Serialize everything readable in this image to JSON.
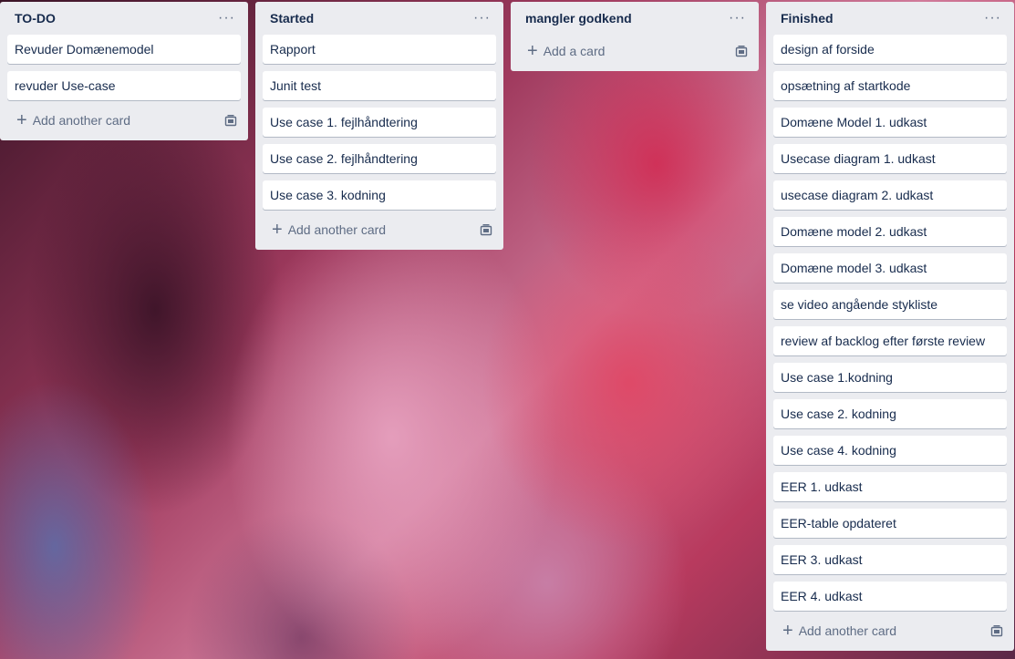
{
  "lists": [
    {
      "title": "TO-DO",
      "menu_icon": "···",
      "cards": [
        "Revuder Domænemodel",
        "revuder Use-case"
      ],
      "add_label": "Add another card"
    },
    {
      "title": "Started",
      "menu_icon": "···",
      "cards": [
        "Rapport",
        "Junit test",
        "Use case 1. fejlhåndtering",
        "Use case 2. fejlhåndtering",
        "Use case 3. kodning"
      ],
      "add_label": "Add another card"
    },
    {
      "title": "mangler godkend",
      "menu_icon": "···",
      "cards": [],
      "add_label": "Add a card"
    },
    {
      "title": "Finished",
      "menu_icon": "···",
      "cards": [
        "design af forside",
        "opsætning af startkode",
        "Domæne Model 1. udkast",
        "Usecase diagram 1. udkast",
        "usecase diagram 2. udkast",
        "Domæne model 2. udkast",
        "Domæne model 3. udkast",
        "se video angående stykliste",
        "review af backlog efter første review",
        "Use case 1.kodning",
        "Use case 2. kodning",
        "Use case 4. kodning",
        "EER 1. udkast",
        "EER-table opdateret",
        "EER 3. udkast",
        "EER 4. udkast"
      ],
      "add_label": "Add another card"
    }
  ],
  "icons": {
    "plus": "+",
    "template": "template-icon"
  }
}
